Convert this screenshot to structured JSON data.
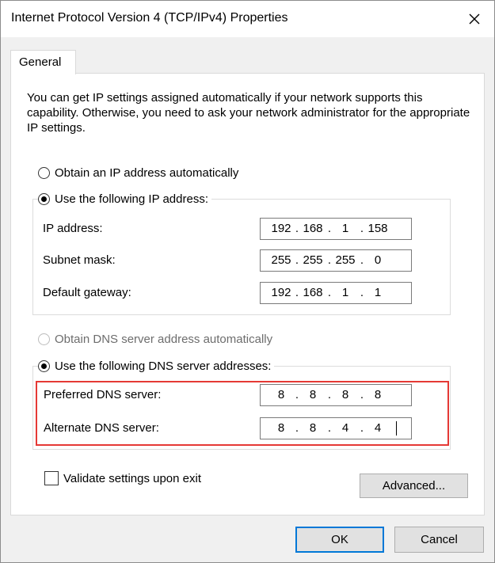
{
  "window": {
    "title": "Internet Protocol Version 4 (TCP/IPv4) Properties"
  },
  "tabs": [
    {
      "label": "General"
    }
  ],
  "description": "You can get IP settings assigned automatically if your network supports this capability. Otherwise, you need to ask your network administrator for the appropriate IP settings.",
  "ip_mode": {
    "auto_label": "Obtain an IP address automatically",
    "manual_label": "Use the following IP address:",
    "selected": "manual"
  },
  "ip_fields": {
    "ip_address": {
      "label": "IP address:",
      "octets": [
        "192",
        "168",
        "1",
        "158"
      ]
    },
    "subnet_mask": {
      "label": "Subnet mask:",
      "octets": [
        "255",
        "255",
        "255",
        "0"
      ]
    },
    "default_gateway": {
      "label": "Default gateway:",
      "octets": [
        "192",
        "168",
        "1",
        "1"
      ]
    }
  },
  "dns_mode": {
    "auto_label": "Obtain DNS server address automatically",
    "auto_enabled": false,
    "manual_label": "Use the following DNS server addresses:",
    "selected": "manual"
  },
  "dns_fields": {
    "preferred": {
      "label": "Preferred DNS server:",
      "octets": [
        "8",
        "8",
        "8",
        "8"
      ]
    },
    "alternate": {
      "label": "Alternate DNS server:",
      "octets": [
        "8",
        "8",
        "4",
        "4"
      ]
    }
  },
  "highlight_color": "#e53935",
  "validate": {
    "label": "Validate settings upon exit",
    "checked": false
  },
  "buttons": {
    "advanced": "Advanced...",
    "ok": "OK",
    "cancel": "Cancel"
  },
  "icons": {
    "close": "close-icon"
  }
}
